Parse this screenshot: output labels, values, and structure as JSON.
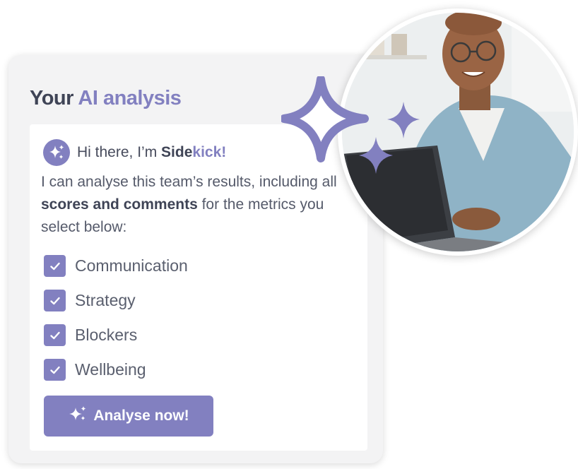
{
  "card": {
    "title_lead": "Your",
    "title_accent": "AI analysis"
  },
  "greeting": {
    "prefix": "Hi there, I’m ",
    "name_part1": "Side",
    "name_part2": "kick!"
  },
  "description": {
    "text_before": "I can analyse this team’s results, including all ",
    "bold": "scores and comments",
    "text_after": " for the metrics you select below:"
  },
  "metrics": [
    {
      "label": "Communication",
      "checked": true
    },
    {
      "label": "Strategy",
      "checked": true
    },
    {
      "label": "Blockers",
      "checked": true
    },
    {
      "label": "Wellbeing",
      "checked": true
    }
  ],
  "button": {
    "label": "Analyse now!",
    "icon": "sparkle-icon"
  },
  "colors": {
    "accent": "#8280c0",
    "dark_text": "#3f4456",
    "card_bg": "#f3f3f4"
  }
}
